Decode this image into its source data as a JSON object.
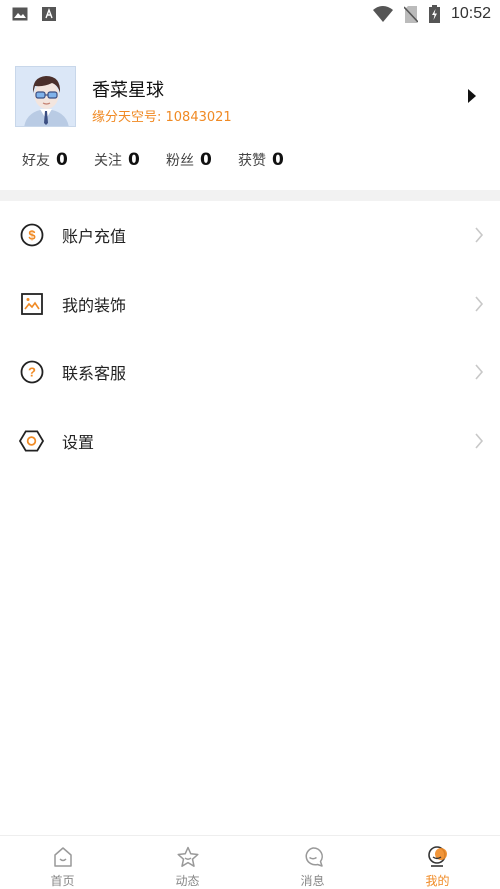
{
  "status_bar": {
    "time": "10:52",
    "icons": [
      "image-notification-icon",
      "text-notification-icon",
      "wifi-icon",
      "no-sim-icon",
      "battery-charging-icon"
    ]
  },
  "profile": {
    "name": "香菜星球",
    "id_text": "缘分天空号: 10843021",
    "avatar_icon": "avatar-glasses-man-icon",
    "arrow_icon": "caret-right-icon"
  },
  "stats": [
    {
      "label": "好友",
      "value": "0"
    },
    {
      "label": "关注",
      "value": "0"
    },
    {
      "label": "粉丝",
      "value": "0"
    },
    {
      "label": "获赞",
      "value": "0"
    }
  ],
  "menu": [
    {
      "label": "账户充值",
      "icon": "coin-dollar-icon"
    },
    {
      "label": "我的装饰",
      "icon": "picture-frame-icon"
    },
    {
      "label": "联系客服",
      "icon": "question-circle-icon"
    },
    {
      "label": "设置",
      "icon": "hexagon-settings-icon"
    }
  ],
  "bottom_nav": [
    {
      "label": "首页",
      "icon": "home-icon",
      "active": false
    },
    {
      "label": "动态",
      "icon": "star-icon",
      "active": false
    },
    {
      "label": "消息",
      "icon": "message-bubble-icon",
      "active": false
    },
    {
      "label": "我的",
      "icon": "profile-icon",
      "active": true
    }
  ],
  "colors": {
    "accent": "#f08a24",
    "text": "#222222",
    "muted": "#888888",
    "band": "#f2f2f2"
  }
}
